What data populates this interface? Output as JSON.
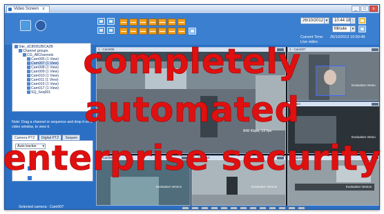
{
  "window": {
    "title": "Video Screen",
    "close": "x",
    "controls": [
      "_",
      "□",
      "x"
    ]
  },
  "header": {
    "date": "26/10/2012",
    "time": "10:44:18",
    "interval": "Minute",
    "current_time_label": "Current Time:",
    "current_time_value": "26/10/2012 10:50:49",
    "live_label": "Live video"
  },
  "tree": {
    "items": [
      "Site_dC80952BCA2B",
      "Channel groups",
      "CG_AllChannels",
      "Cam005 (1 View)",
      "Cam007 (1 View)",
      "Cam008 (1 View)",
      "Cam009 (1 View)",
      "Cam010 (1 View)",
      "Cam011 (1 View)",
      "Cam015 (1 View)",
      "Cam017 (1 View)",
      "SQ_Seq001"
    ]
  },
  "left": {
    "note": "Note: Drag a channel or sequence and drop it on a video window, to view it.",
    "tabs": [
      "Camera PTZ",
      "Digital PTZ",
      "Sequen"
    ],
    "auto_tracker": "Auto tracker",
    "selected_camera": "Selected camera : Cam007"
  },
  "panes": [
    {
      "label": "1 - Cam006",
      "overlay": "848 Kbps, 12 fps"
    },
    {
      "label": "2 - Cam007",
      "overlay": "Evaluation Versio"
    },
    {
      "label": "3 - Cam",
      "overlay": "Evaluation Versio"
    },
    {
      "label": "4 - Cam009",
      "overlay": "Evaluation Version"
    },
    {
      "label": "5 - Cam010",
      "overlay": "Evaluation Version"
    },
    {
      "label": "6 - Cam015",
      "overlay": "Evaluation Version"
    }
  ],
  "overlay": {
    "line1": "completely",
    "line2": "automated",
    "line3": "enterprise security"
  },
  "colors": {
    "window_bg": "#2a6fc4",
    "overlay_text": "#e01010",
    "layout_buttons": "#f0a020"
  }
}
